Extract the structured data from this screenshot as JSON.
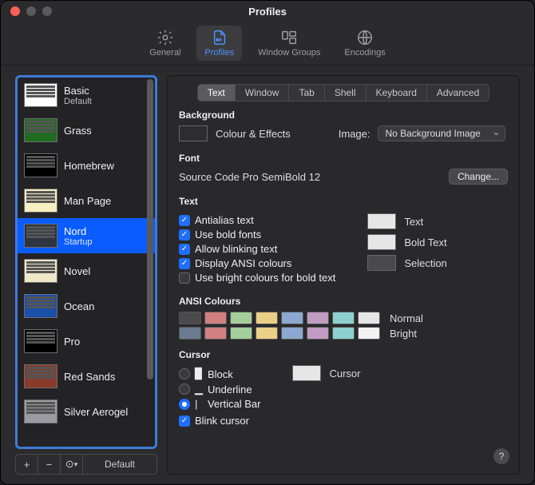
{
  "window": {
    "title": "Profiles"
  },
  "toolbar": {
    "items": [
      {
        "label": "General"
      },
      {
        "label": "Profiles"
      },
      {
        "label": "Window Groups"
      },
      {
        "label": "Encodings"
      }
    ]
  },
  "sidebar": {
    "profiles": [
      {
        "name": "Basic",
        "sub": "Default"
      },
      {
        "name": "Grass"
      },
      {
        "name": "Homebrew"
      },
      {
        "name": "Man Page"
      },
      {
        "name": "Nord",
        "sub": "Startup",
        "selected": true
      },
      {
        "name": "Novel"
      },
      {
        "name": "Ocean"
      },
      {
        "name": "Pro"
      },
      {
        "name": "Red Sands"
      },
      {
        "name": "Silver Aerogel"
      }
    ],
    "footer_default_label": "Default"
  },
  "tabs": {
    "items": [
      "Text",
      "Window",
      "Tab",
      "Shell",
      "Keyboard",
      "Advanced"
    ],
    "selected": "Text"
  },
  "background": {
    "section_title": "Background",
    "colour_effects_label": "Colour & Effects",
    "image_label": "Image:",
    "image_select": "No Background Image"
  },
  "font": {
    "section_title": "Font",
    "current": "Source Code Pro SemiBold 12",
    "change_button": "Change..."
  },
  "text": {
    "section_title": "Text",
    "antialias": {
      "label": "Antialias text",
      "checked": true
    },
    "bold_fonts": {
      "label": "Use bold fonts",
      "checked": true
    },
    "blinking": {
      "label": "Allow blinking text",
      "checked": true
    },
    "ansi": {
      "label": "Display ANSI colours",
      "checked": true
    },
    "bright_bold": {
      "label": "Use bright colours for bold text",
      "checked": false
    },
    "text_well_label": "Text",
    "bold_well_label": "Bold Text",
    "selection_well_label": "Selection",
    "wells": {
      "text": "#e6e6e6",
      "bold": "#e6e6e6",
      "selection": "#4a4a4d"
    }
  },
  "ansi": {
    "section_title": "ANSI Colours",
    "normal_label": "Normal",
    "bright_label": "Bright",
    "normal": [
      "#4a4a4d",
      "#d08081",
      "#a4cf9b",
      "#eccf86",
      "#8ca8d0",
      "#c29bc2",
      "#8dd0cf",
      "#e6e6e6"
    ],
    "bright": [
      "#6a7a90",
      "#d08081",
      "#a4cf9b",
      "#eccf86",
      "#8ca8d0",
      "#c29bc2",
      "#8dd0cf",
      "#f2f2f2"
    ]
  },
  "cursor": {
    "section_title": "Cursor",
    "block": {
      "label": "Block",
      "on": false,
      "glyph": "▉"
    },
    "underline": {
      "label": "Underline",
      "on": false,
      "glyph": "▁"
    },
    "vbar": {
      "label": "Vertical Bar",
      "on": true,
      "glyph": "|"
    },
    "blink": {
      "label": "Blink cursor",
      "checked": true
    },
    "cursor_well_label": "Cursor",
    "well": "#e6e6e6"
  },
  "help": {
    "label": "?"
  }
}
